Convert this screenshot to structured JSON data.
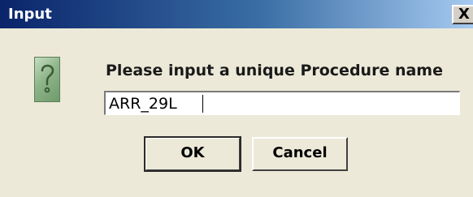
{
  "window": {
    "title": "Input",
    "close_label": "X"
  },
  "dialog": {
    "icon": "question-icon",
    "prompt": "Please input a unique Procedure name",
    "input_value": "ARR_29L",
    "ok_label": "OK",
    "cancel_label": "Cancel"
  },
  "colors": {
    "titlebar_start": "#0A246A",
    "titlebar_end": "#A6CAF0",
    "dialog_background": "#ECE9D8",
    "icon_green": "#8FB58A"
  }
}
